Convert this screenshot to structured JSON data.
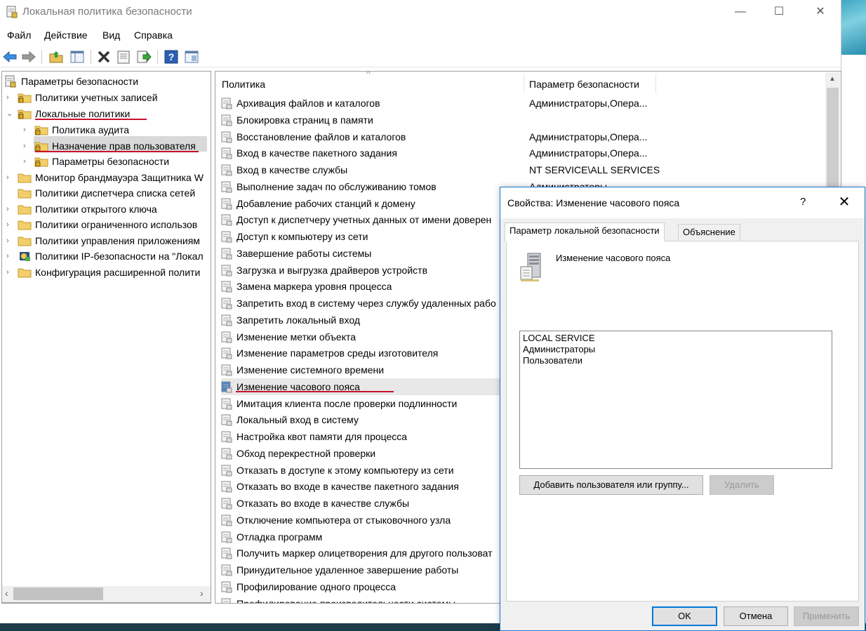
{
  "window": {
    "title": "Локальная политика безопасности",
    "controls": {
      "minimize": "—",
      "maximize": "☐",
      "close": "✕"
    }
  },
  "menu": [
    "Файл",
    "Действие",
    "Вид",
    "Справка"
  ],
  "toolbar_icons": [
    "back-arrow-icon",
    "forward-arrow-icon",
    "up-folder-icon",
    "show-hide-tree-icon",
    "delete-icon",
    "properties-icon",
    "export-icon",
    "help-icon",
    "view-icon"
  ],
  "tree": {
    "root": "Параметры безопасности",
    "items": [
      {
        "label": "Политики учетных записей",
        "arrow": "›"
      },
      {
        "label": "Локальные политики",
        "arrow": "⌄"
      },
      {
        "label": "Политика аудита",
        "arrow": "›"
      },
      {
        "label": "Назначение прав пользователя",
        "arrow": "›"
      },
      {
        "label": "Параметры безопасности",
        "arrow": "›"
      },
      {
        "label": "Монитор брандмауэра Защитника W",
        "arrow": "›"
      },
      {
        "label": "Политики диспетчера списка сетей",
        "arrow": ""
      },
      {
        "label": "Политики открытого ключа",
        "arrow": "›"
      },
      {
        "label": "Политики ограниченного использов",
        "arrow": "›"
      },
      {
        "label": "Политики управления приложениям",
        "arrow": "›"
      },
      {
        "label": "Политики IP-безопасности на \"Локал",
        "arrow": "›"
      },
      {
        "label": "Конфигурация расширенной полити",
        "arrow": "›"
      }
    ],
    "scroll_left": "‹",
    "scroll_right": "›"
  },
  "list": {
    "columns": [
      "Политика",
      "Параметр безопасности"
    ],
    "sort_indicator": "^",
    "rows": [
      {
        "name": "Архивация файлов и каталогов",
        "value": "Администраторы,Опера..."
      },
      {
        "name": "Блокировка страниц в памяти",
        "value": ""
      },
      {
        "name": "Восстановление файлов и каталогов",
        "value": "Администраторы,Опера..."
      },
      {
        "name": "Вход в качестве пакетного задания",
        "value": "Администраторы,Опера..."
      },
      {
        "name": "Вход в качестве службы",
        "value": "NT SERVICE\\ALL SERVICES"
      },
      {
        "name": "Выполнение задач по обслуживанию томов",
        "value": "Администраторы"
      },
      {
        "name": "Добавление рабочих станций к домену",
        "value": ""
      },
      {
        "name": "Доступ к диспетчеру учетных данных от имени доверен",
        "value": ""
      },
      {
        "name": "Доступ к компьютеру из сети",
        "value": ""
      },
      {
        "name": "Завершение работы системы",
        "value": ""
      },
      {
        "name": "Загрузка и выгрузка драйверов устройств",
        "value": ""
      },
      {
        "name": "Замена маркера уровня процесса",
        "value": ""
      },
      {
        "name": "Запретить вход в систему через службу удаленных рабо",
        "value": ""
      },
      {
        "name": "Запретить локальный вход",
        "value": ""
      },
      {
        "name": "Изменение метки объекта",
        "value": ""
      },
      {
        "name": "Изменение параметров среды изготовителя",
        "value": ""
      },
      {
        "name": "Изменение системного времени",
        "value": ""
      },
      {
        "name": "Изменение часового пояса",
        "value": ""
      },
      {
        "name": "Имитация клиента после проверки подлинности",
        "value": ""
      },
      {
        "name": "Локальный вход в систему",
        "value": ""
      },
      {
        "name": "Настройка квот памяти для процесса",
        "value": ""
      },
      {
        "name": "Обход перекрестной проверки",
        "value": ""
      },
      {
        "name": "Отказать в доступе к этому компьютеру из сети",
        "value": ""
      },
      {
        "name": "Отказать во входе в качестве пакетного задания",
        "value": ""
      },
      {
        "name": "Отказать во входе в качестве службы",
        "value": ""
      },
      {
        "name": "Отключение компьютера от стыковочного узла",
        "value": ""
      },
      {
        "name": "Отладка программ",
        "value": ""
      },
      {
        "name": "Получить маркер олицетворения для другого пользоват",
        "value": ""
      },
      {
        "name": "Принудительное удаленное завершение работы",
        "value": ""
      },
      {
        "name": "Профилирование одного процесса",
        "value": ""
      },
      {
        "name": "Профилирование производительности системы",
        "value": ""
      }
    ]
  },
  "dialog": {
    "title": "Свойства: Изменение часового пояса",
    "help": "?",
    "close": "✕",
    "tabs": [
      "Параметр локальной безопасности",
      "Объяснение"
    ],
    "policy_name": "Изменение часового пояса",
    "accounts": [
      "LOCAL SERVICE",
      "Администраторы",
      "Пользователи"
    ],
    "add_button": "Добавить пользователя или группу...",
    "remove_button": "Удалить",
    "ok": "OK",
    "cancel": "Отмена",
    "apply": "Применить"
  },
  "colors": {
    "accent": "#0078d7",
    "highlight_underline": "#c8102e",
    "selection": "#d9d9d9"
  }
}
